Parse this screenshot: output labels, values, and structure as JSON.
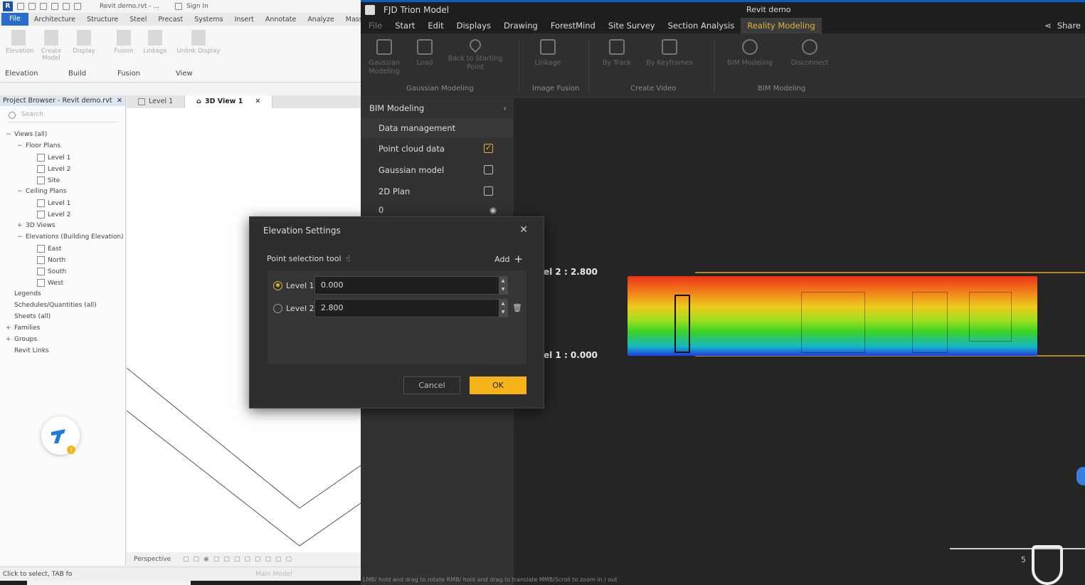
{
  "revit": {
    "title": "Revit demo.rvt - ...",
    "sign_in": "Sign In",
    "tabs": [
      "File",
      "Architecture",
      "Structure",
      "Steel",
      "Precast",
      "Systems",
      "Insert",
      "Annotate",
      "Analyze",
      "Massing"
    ],
    "ribbon_buttons": [
      "Elevation",
      "Create Model",
      "Display",
      "Fusion",
      "Linkage",
      "Unlink Display"
    ],
    "ribbon_groups": [
      "Elevation",
      "Build",
      "Fusion",
      "View"
    ],
    "project_browser_title": "Project Browser - Revit demo.rvt",
    "search_placeholder": "Search",
    "tree": [
      {
        "label": "Views (all)",
        "level": 0,
        "exp": "−",
        "box": false
      },
      {
        "label": "Floor Plans",
        "level": 1,
        "exp": "−",
        "box": false
      },
      {
        "label": "Level 1",
        "level": 2,
        "exp": "",
        "box": true
      },
      {
        "label": "Level 2",
        "level": 2,
        "exp": "",
        "box": true
      },
      {
        "label": "Site",
        "level": 2,
        "exp": "",
        "box": true
      },
      {
        "label": "Ceiling Plans",
        "level": 1,
        "exp": "−",
        "box": false
      },
      {
        "label": "Level 1",
        "level": 2,
        "exp": "",
        "box": true
      },
      {
        "label": "Level 2",
        "level": 2,
        "exp": "",
        "box": true
      },
      {
        "label": "3D Views",
        "level": 1,
        "exp": "+",
        "box": false
      },
      {
        "label": "Elevations (Building Elevation)",
        "level": 1,
        "exp": "−",
        "box": false
      },
      {
        "label": "East",
        "level": 2,
        "exp": "",
        "box": true
      },
      {
        "label": "North",
        "level": 2,
        "exp": "",
        "box": true
      },
      {
        "label": "South",
        "level": 2,
        "exp": "",
        "box": true
      },
      {
        "label": "West",
        "level": 2,
        "exp": "",
        "box": true
      },
      {
        "label": "Legends",
        "level": 0,
        "exp": "",
        "box": false
      },
      {
        "label": "Schedules/Quantities (all)",
        "level": 0,
        "exp": "",
        "box": false
      },
      {
        "label": "Sheets (all)",
        "level": 0,
        "exp": "",
        "box": false
      },
      {
        "label": "Families",
        "level": 0,
        "exp": "+",
        "box": false
      },
      {
        "label": "Groups",
        "level": 0,
        "exp": "+",
        "box": false
      },
      {
        "label": "Revit Links",
        "level": 0,
        "exp": "",
        "box": false
      }
    ],
    "view_tabs": [
      "Level 1",
      "3D View 1"
    ],
    "viewbar_label": "Perspective",
    "status": "Click to select, TAB fo",
    "main_model": "Main Model"
  },
  "trion": {
    "app_title": "FJD Trion Model",
    "doc_title": "Revit demo",
    "share": "Share",
    "menu": [
      "File",
      "Start",
      "Edit",
      "Displays",
      "Drawing",
      "ForestMind",
      "Site Survey",
      "Section Analysis",
      "Reality Modeling"
    ],
    "toolbar": [
      {
        "label": "Gaussian Modeling"
      },
      {
        "label": "Load"
      },
      {
        "label": "Back to Starting Point"
      },
      {
        "label": "Linkage"
      },
      {
        "label": "By Track"
      },
      {
        "label": "By Keyframes"
      },
      {
        "label": "BIM Modeling"
      },
      {
        "label": "Disconnect"
      }
    ],
    "toolbar_groups": [
      "Gaussian Modeling",
      "Image Fusion",
      "Create Video",
      "BIM Modeling"
    ],
    "panel": {
      "title": "BIM Modeling",
      "rows": [
        {
          "label": "Data management"
        },
        {
          "label": "Point cloud data",
          "checked": true
        },
        {
          "label": "Gaussian model",
          "checked": false
        },
        {
          "label": "2D Plan",
          "checked": false
        },
        {
          "label": "0"
        }
      ]
    },
    "levels": {
      "level2": "el 2 : 2.800",
      "level1": "el 1 : 0.000"
    },
    "bottom_hint": "LMB/ hold and drag to rotate RMB/ hold and drag to translate MMB/Scroll to zoom in / out",
    "scale_value": "5"
  },
  "dialog": {
    "title": "Elevation Settings",
    "point_tool": "Point selection tool",
    "add": "Add",
    "rows": [
      {
        "name": "Level 1",
        "value": "0.000",
        "selected": true
      },
      {
        "name": "Level 2",
        "value": "2.800",
        "selected": false
      }
    ],
    "cancel": "Cancel",
    "ok": "OK"
  }
}
